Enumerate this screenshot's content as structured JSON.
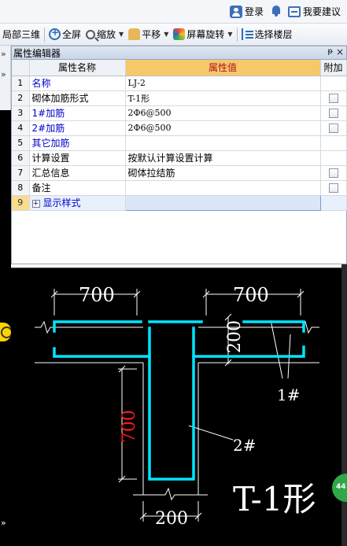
{
  "header": {
    "login_label": "登录",
    "suggest_label": "我要建议"
  },
  "toolbar": {
    "local3d_label": "局部三维",
    "fullscreen_label": "全屏",
    "zoom_label": "缩放",
    "pan_label": "平移",
    "rotate_label": "屏幕旋转",
    "floor_label": "选择楼层"
  },
  "panel": {
    "title": "属性编辑器",
    "pin_glyph": "ᵽ",
    "close_glyph": "×",
    "columns": {
      "name": "属性名称",
      "value": "属性值",
      "extra": "附加"
    },
    "rows": [
      {
        "num": "1",
        "name": "名称",
        "value": "LJ-2",
        "blue": true,
        "check": false
      },
      {
        "num": "2",
        "name": "砌体加筋形式",
        "value": "T-1形",
        "blue": false,
        "check": true
      },
      {
        "num": "3",
        "name": "1#加筋",
        "value": "2Φ6@500",
        "blue": true,
        "check": true
      },
      {
        "num": "4",
        "name": "2#加筋",
        "value": "2Φ6@500",
        "blue": true,
        "check": true
      },
      {
        "num": "5",
        "name": "其它加筋",
        "value": "",
        "blue": true,
        "check": false
      },
      {
        "num": "6",
        "name": "计算设置",
        "value": "按默认计算设置计算",
        "blue": false,
        "check": false
      },
      {
        "num": "7",
        "name": "汇总信息",
        "value": "砌体拉结筋",
        "blue": false,
        "check": true
      },
      {
        "num": "8",
        "name": "备注",
        "value": "",
        "blue": false,
        "check": true
      },
      {
        "num": "9",
        "name": "显示样式",
        "value": "",
        "blue": true,
        "check": false,
        "expander": "+"
      }
    ]
  },
  "drawing": {
    "dim_left": "700",
    "dim_right": "700",
    "dim_200_right": "200",
    "dim_700_vertical": "700",
    "dim_200_bottom": "200",
    "label_1": "1#",
    "label_2": "2#",
    "shape_title": "T-1形",
    "colors": {
      "rebar": "#00e5ff",
      "dim_line": "#ffffff",
      "dim_red": "#ff1a1a",
      "background": "#000000"
    }
  },
  "left_strip": {
    "chevron": "»"
  },
  "badge": {
    "text": "44"
  }
}
